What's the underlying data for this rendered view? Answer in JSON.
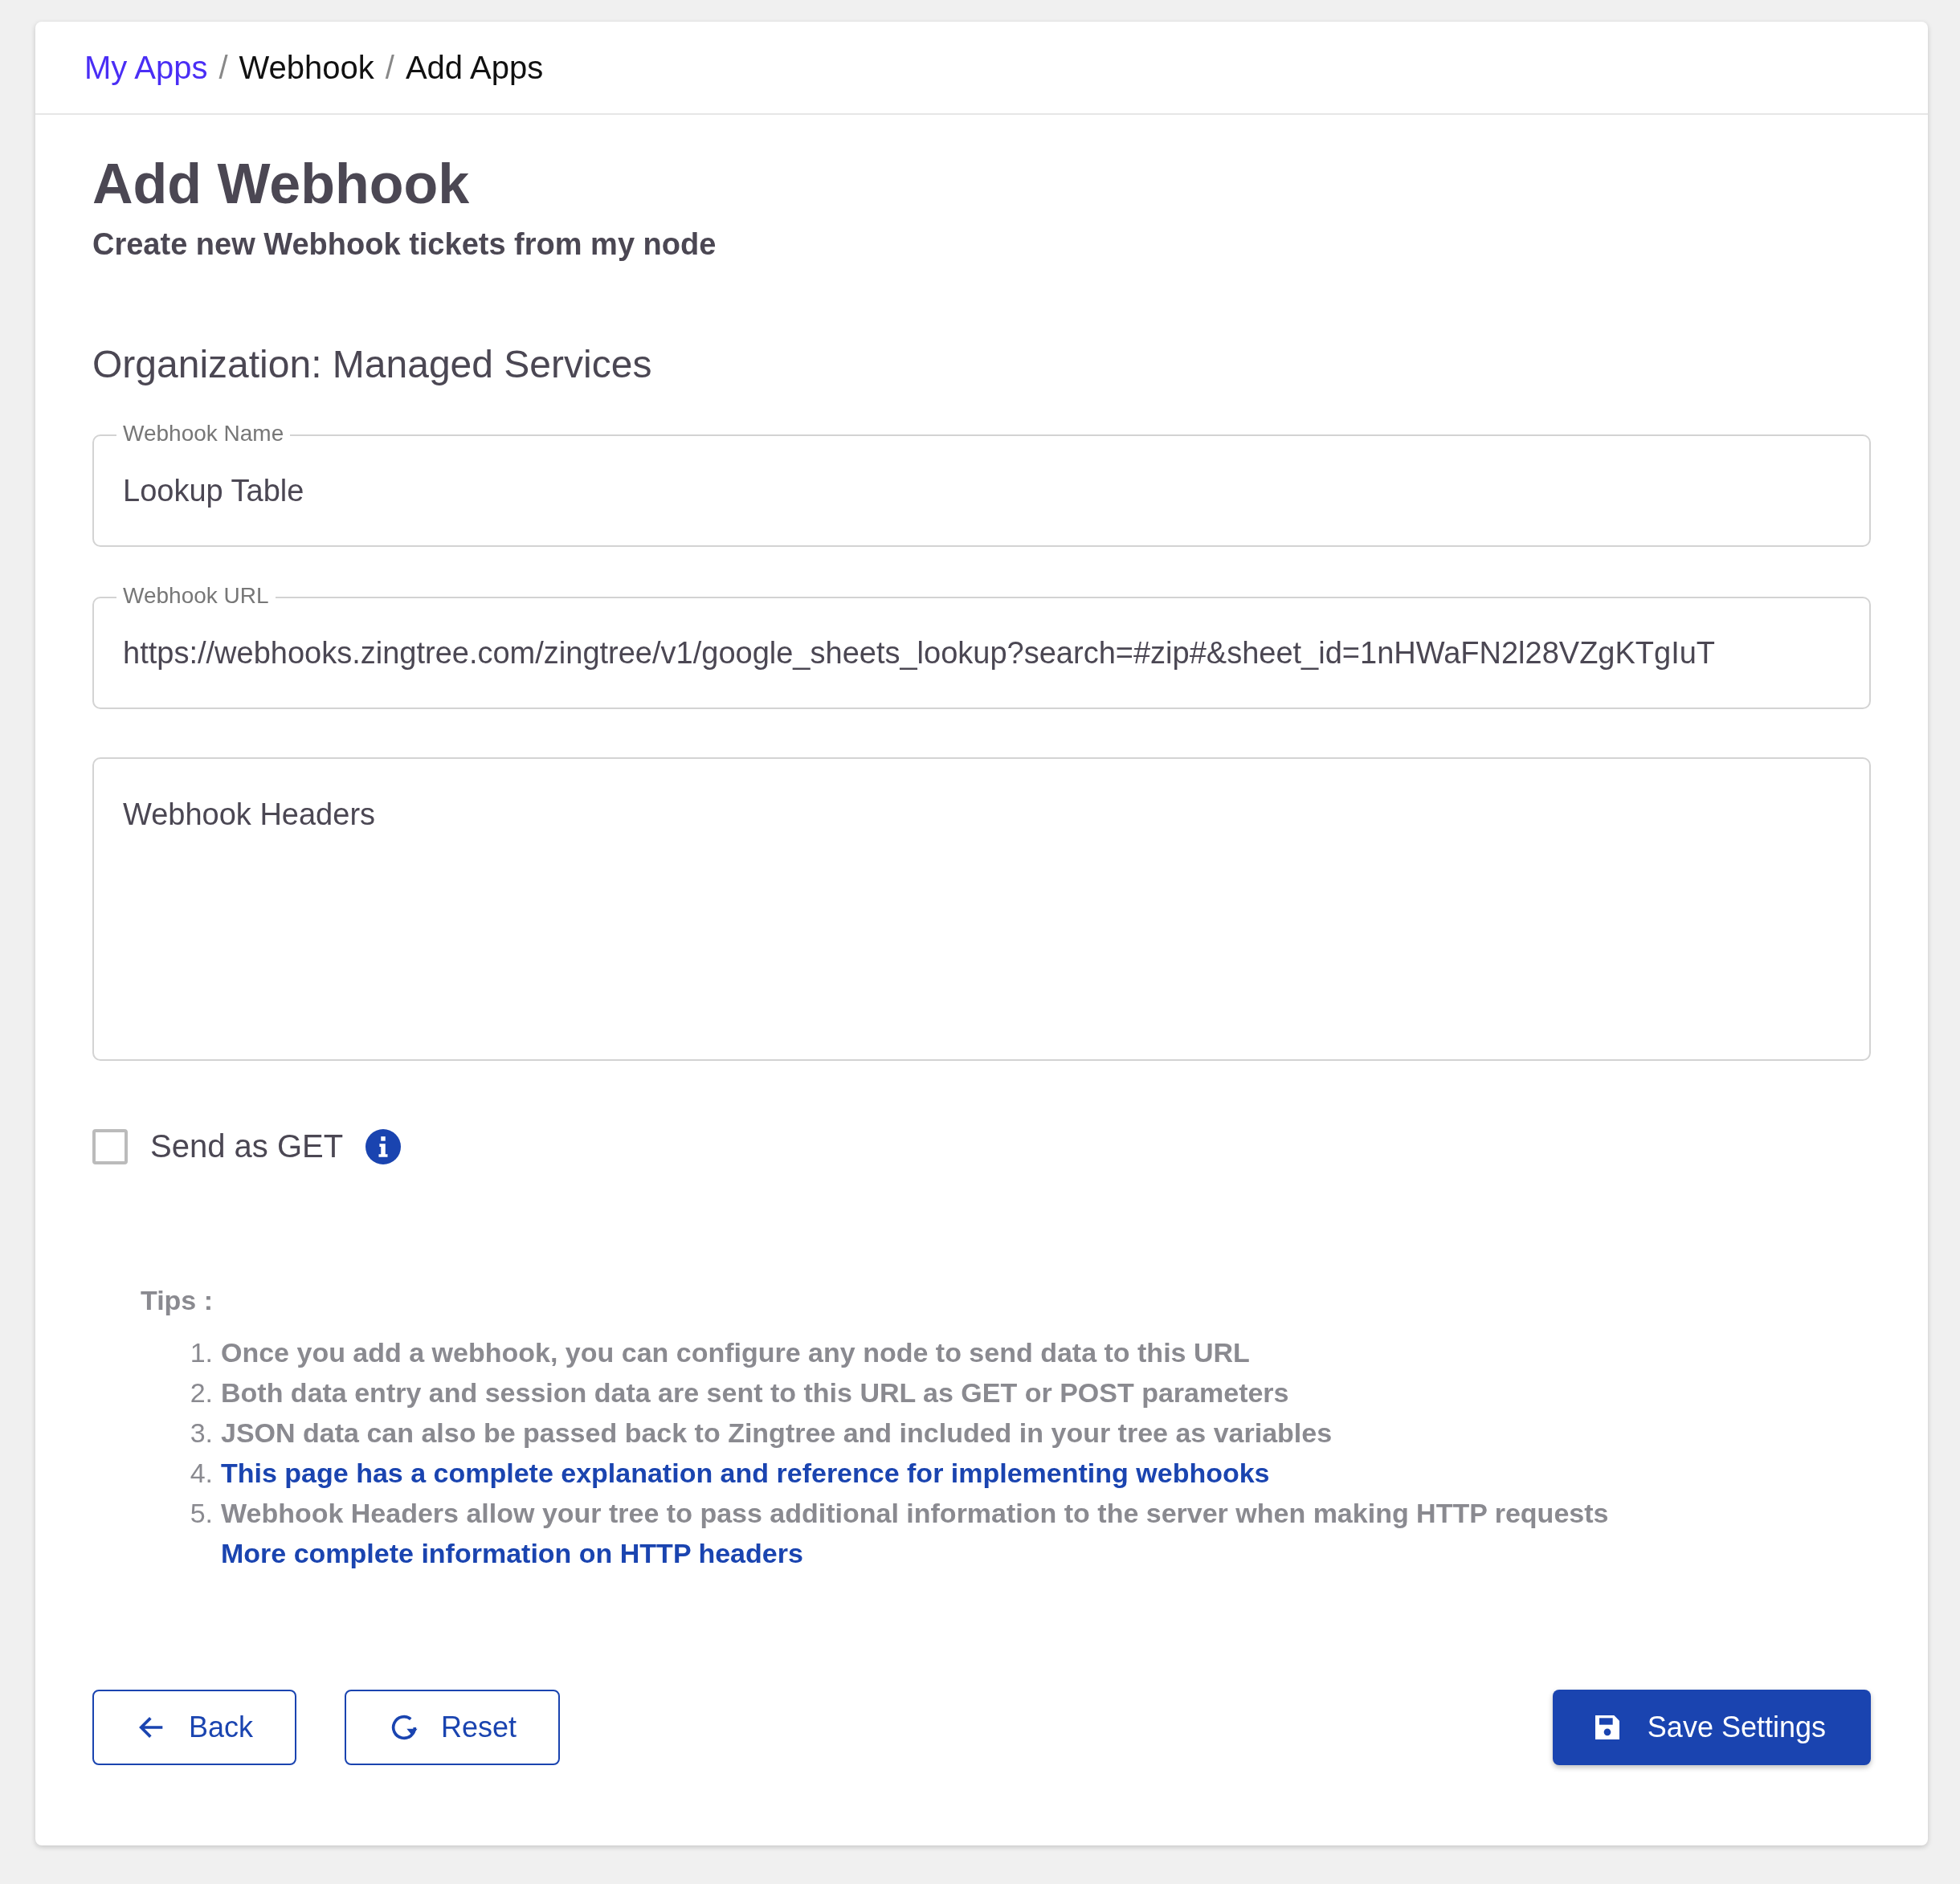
{
  "breadcrumb": {
    "separator": "/",
    "items": [
      {
        "label": "My Apps",
        "kind": "link"
      },
      {
        "label": "Webhook",
        "kind": "current"
      },
      {
        "label": "Add Apps",
        "kind": "current"
      }
    ]
  },
  "title": "Add Webhook",
  "subtitle": "Create new Webhook tickets from my node",
  "organization": "Organization: Managed Services",
  "fields": [
    {
      "label": "Webhook Name",
      "value": "Lookup Table"
    },
    {
      "label": "Webhook URL",
      "value": "https://webhooks.zingtree.com/zingtree/v1/google_sheets_lookup?search=#zip#&sheet_id=1nHWaFN2l28VZgKTgIuT"
    }
  ],
  "headers": {
    "placeholder": "Webhook Headers"
  },
  "send_as_get": {
    "label": "Send as GET",
    "checked": false
  },
  "tips": {
    "title": "Tips :",
    "items": [
      {
        "number": "1.",
        "text": "Once you add a webhook, you can configure any node to send data to this URL",
        "kind": "text"
      },
      {
        "number": "2.",
        "text": "Both data entry and session data are sent to this URL as GET or POST parameters",
        "kind": "text"
      },
      {
        "number": "3.",
        "text": "JSON data can also be passed back to Zingtree and included in your tree as variables",
        "kind": "text"
      },
      {
        "number": "4.",
        "text": "This page has a complete explanation and reference for implementing webhooks",
        "kind": "link"
      },
      {
        "number": "5.",
        "text": "Webhook Headers allow your tree to pass additional information to the server when making HTTP requests",
        "kind": "text",
        "link": "More complete information on HTTP headers"
      }
    ]
  },
  "buttons": {
    "back": "Back",
    "reset": "Reset",
    "save": "Save Settings"
  }
}
